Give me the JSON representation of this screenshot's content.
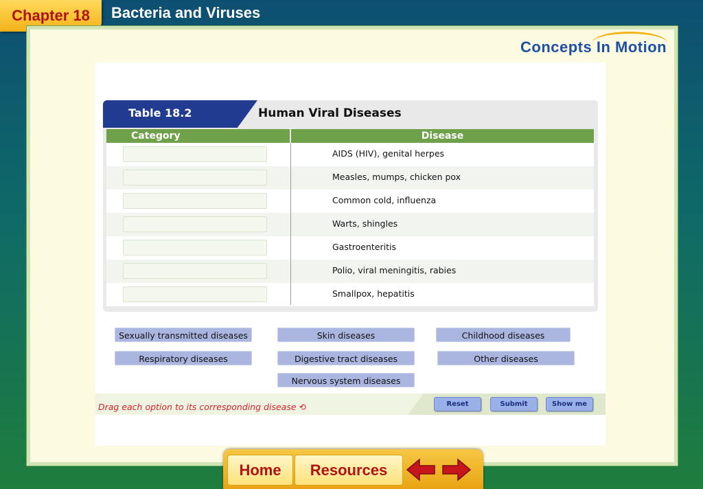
{
  "header": {
    "chapter_label": "Chapter 18",
    "page_title": "Bacteria and Viruses"
  },
  "logo": {
    "text": "Concepts In Motion"
  },
  "table": {
    "number": "Table 18.2",
    "title": "Human Viral Diseases",
    "columns": {
      "category": "Category",
      "disease": "Disease"
    },
    "diseases": [
      "AIDS (HIV), genital herpes",
      "Measles, mumps, chicken pox",
      "Common cold, influenza",
      "Warts, shingles",
      "Gastroenteritis",
      "Polio, viral meningitis, rabies",
      "Smallpox, hepatitis"
    ]
  },
  "options": {
    "sexually_transmitted": "Sexually transmitted diseases",
    "skin": "Skin diseases",
    "childhood": "Childhood diseases",
    "respiratory": "Respiratory diseases",
    "digestive": "Digestive tract diseases",
    "other": "Other diseases",
    "nervous": "Nervous system diseases"
  },
  "footer": {
    "instruction": "Drag each option to its corresponding disease",
    "reset_label": "Reset",
    "submit_label": "Submit",
    "show_me_label": "Show me"
  },
  "nav": {
    "home_label": "Home",
    "resources_label": "Resources"
  },
  "colors": {
    "brand_red": "#b01313",
    "table_blue": "#203b90",
    "header_green": "#6fa14a",
    "option_blue": "#aab6e0"
  }
}
